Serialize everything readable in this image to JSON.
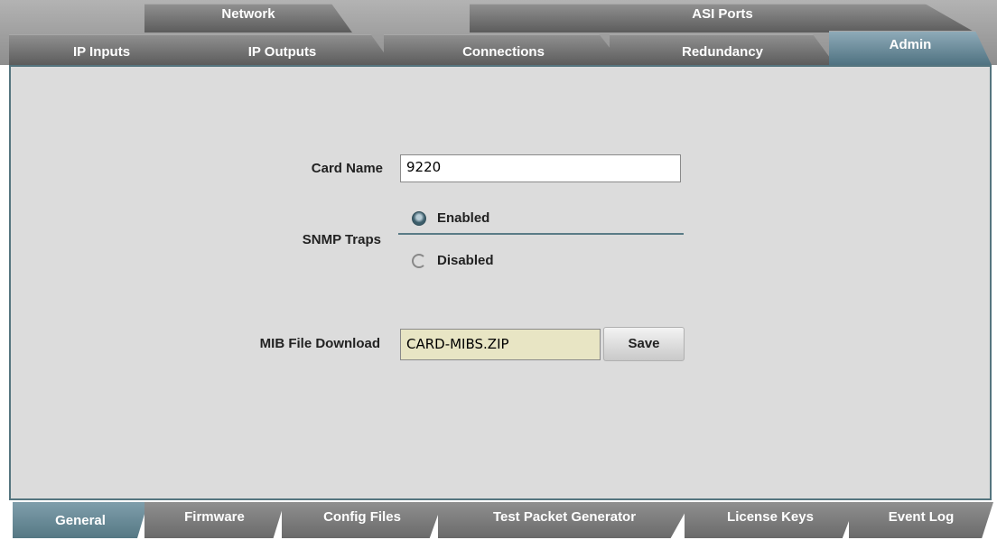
{
  "top_tabs": {
    "row1": [
      "Network",
      "ASI Ports"
    ],
    "row2": [
      "IP Inputs",
      "IP Outputs",
      "Connections",
      "Redundancy",
      "Admin"
    ],
    "active": "Admin"
  },
  "form": {
    "card_name_label": "Card Name",
    "card_name_value": "9220",
    "snmp_label": "SNMP Traps",
    "snmp_options": [
      "Enabled",
      "Disabled"
    ],
    "snmp_selected": "Enabled",
    "mib_label": "MIB File Download",
    "mib_value": "CARD-MIBS.ZIP",
    "save_label": "Save"
  },
  "bottom_tabs": {
    "items": [
      "General",
      "Firmware",
      "Config Files",
      "Test Packet Generator",
      "License Keys",
      "Event Log"
    ],
    "active": "General"
  },
  "colors": {
    "accent": "#4f7281",
    "panel_bg": "#dcdcdc",
    "mib_field_bg": "#e8e5c4"
  }
}
